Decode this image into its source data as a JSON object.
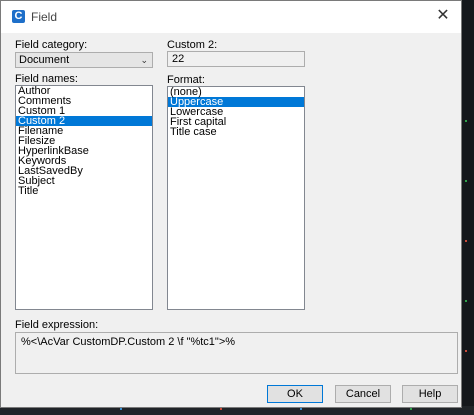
{
  "window": {
    "title": "Field",
    "app_icon_letter": "C",
    "close_glyph": "✕"
  },
  "field_category": {
    "label": "Field category:",
    "value": "Document"
  },
  "field_names": {
    "label": "Field names:",
    "items": [
      "Author",
      "Comments",
      "Custom 1",
      "Custom 2",
      "Filename",
      "Filesize",
      "HyperlinkBase",
      "Keywords",
      "LastSavedBy",
      "Subject",
      "Title"
    ],
    "selected": "Custom 2"
  },
  "custom": {
    "label": "Custom 2:",
    "value": "22"
  },
  "format": {
    "label": "Format:",
    "items": [
      "(none)",
      "Uppercase",
      "Lowercase",
      "First capital",
      "Title case"
    ],
    "selected": "Uppercase"
  },
  "expression": {
    "label": "Field expression:",
    "value": "%<\\AcVar CustomDP.Custom 2 \\f \"%tc1\">%"
  },
  "buttons": {
    "ok": "OK",
    "cancel": "Cancel",
    "help": "Help"
  },
  "colors": {
    "selection": "#0078d7",
    "dialog_bg": "#f0f0f0"
  }
}
